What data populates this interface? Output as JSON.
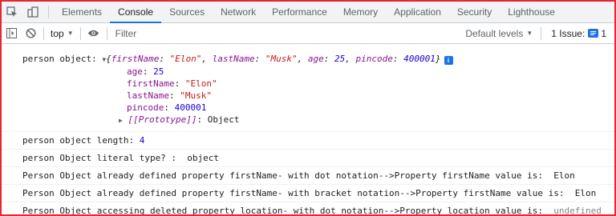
{
  "tabs": [
    {
      "label": "Elements"
    },
    {
      "label": "Console",
      "active": true
    },
    {
      "label": "Sources"
    },
    {
      "label": "Network"
    },
    {
      "label": "Performance"
    },
    {
      "label": "Memory"
    },
    {
      "label": "Application"
    },
    {
      "label": "Security"
    },
    {
      "label": "Lighthouse"
    }
  ],
  "toolbar": {
    "context": "top",
    "filter_placeholder": "Filter",
    "levels_label": "Default levels",
    "issues_label": "1 Issue:",
    "issues_count": "1"
  },
  "colors": {
    "accent": "#1a73e8",
    "border_highlight": "#e8262d",
    "key_color": "#881391",
    "string_color": "#c41a16",
    "number_color": "#1c00cf"
  },
  "icons": [
    "inspect-element-icon",
    "device-toggle-icon",
    "sidebar-toggle-icon",
    "clear-console-icon",
    "eye-icon",
    "issue-message-icon",
    "info-icon"
  ],
  "logs": {
    "obj": {
      "label": "person object: ",
      "head_open": "{",
      "k1": "firstName",
      "v1": "\"Elon\"",
      "k2": "lastName",
      "v2": "\"Musk\"",
      "k3": "age",
      "v3": "25",
      "k4": "pincode",
      "v4": "400001",
      "head_close": "}",
      "info": "i",
      "props": [
        {
          "key": "age",
          "value": "25",
          "type": "number"
        },
        {
          "key": "firstName",
          "value": "\"Elon\"",
          "type": "string"
        },
        {
          "key": "lastName",
          "value": "\"Musk\"",
          "type": "string"
        },
        {
          "key": "pincode",
          "value": "400001",
          "type": "number"
        }
      ],
      "proto_key": "[[Prototype]]",
      "proto_value": "Object"
    },
    "length": {
      "label": "person object length: ",
      "value": "4"
    },
    "literal_type": "person Object literal type? :  object",
    "dot_notation": "Person Object already defined property firstName- with dot notation-->Property firstName value is:  Elon",
    "bracket_notation": "Person Object already defined property firstName- with bracket notation-->Property firstName value is:  Elon",
    "deleted": {
      "label": "Person Object accessing deleted property location- with dot notation-->Property location value is:  ",
      "value": "undefined"
    }
  }
}
